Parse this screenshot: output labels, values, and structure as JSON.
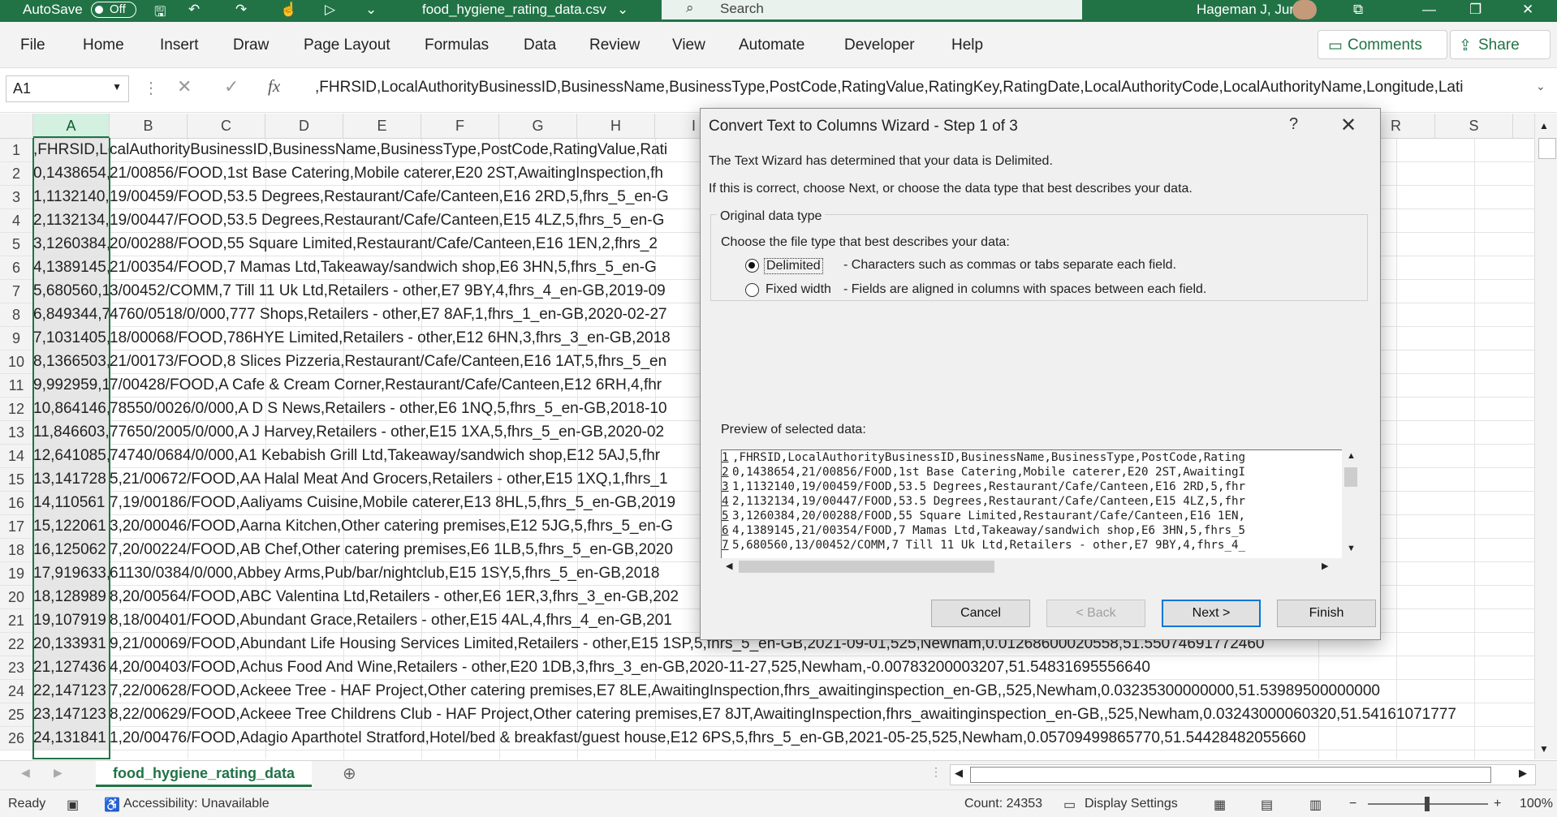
{
  "titlebar": {
    "autosave_label": "AutoSave",
    "autosave_state": "Off",
    "filename": "food_hygiene_rating_data.csv",
    "search_placeholder": "Search",
    "user_name": "Hageman J, Jurre"
  },
  "ribbon": {
    "menu": [
      "File",
      "Home",
      "Insert",
      "Draw",
      "Page Layout",
      "Formulas",
      "Data",
      "Review",
      "View",
      "Automate",
      "Developer",
      "Help"
    ],
    "comments_label": "Comments",
    "share_label": "Share"
  },
  "formula_bar": {
    "name_box": "A1",
    "fx_label": "fx",
    "content": ",FHRSID,LocalAuthorityBusinessID,BusinessName,BusinessType,PostCode,RatingValue,RatingKey,RatingDate,LocalAuthorityCode,LocalAuthorityName,Longitude,Lati"
  },
  "grid": {
    "columns": [
      "A",
      "B",
      "C",
      "D",
      "E",
      "F",
      "G",
      "H",
      "I",
      "R",
      "S"
    ],
    "rows": [
      {
        "n": "1",
        "a": ",FHRSID,Lo",
        "rest": "calAuthorityBusinessID,BusinessName,BusinessType,PostCode,RatingValue,Rati"
      },
      {
        "n": "2",
        "a": "0,1438654,",
        "rest": "21/00856/FOOD,1st Base Catering,Mobile caterer,E20 2ST,AwaitingInspection,fh"
      },
      {
        "n": "3",
        "a": "1,1132140,",
        "rest": "19/00459/FOOD,53.5 Degrees,Restaurant/Cafe/Canteen,E16 2RD,5,fhrs_5_en-G"
      },
      {
        "n": "4",
        "a": "2,1132134,",
        "rest": "19/00447/FOOD,53.5 Degrees,Restaurant/Cafe/Canteen,E15 4LZ,5,fhrs_5_en-G"
      },
      {
        "n": "5",
        "a": "3,1260384,",
        "rest": "20/00288/FOOD,55 Square Limited,Restaurant/Cafe/Canteen,E16 1EN,2,fhrs_2"
      },
      {
        "n": "6",
        "a": "4,1389145,",
        "rest": "21/00354/FOOD,7 Mamas Ltd,Takeaway/sandwich shop,E6 3HN,5,fhrs_5_en-G"
      },
      {
        "n": "7",
        "a": "5,680560,1",
        "rest": "3/00452/COMM,7 Till 11 Uk Ltd,Retailers - other,E7 9BY,4,fhrs_4_en-GB,2019-09"
      },
      {
        "n": "8",
        "a": "6,849344,7",
        "rest": "4760/0518/0/000,777 Shops,Retailers - other,E7 8AF,1,fhrs_1_en-GB,2020-02-27"
      },
      {
        "n": "9",
        "a": "7,1031405,",
        "rest": "18/00068/FOOD,786HYE Limited,Retailers - other,E12 6HN,3,fhrs_3_en-GB,2018"
      },
      {
        "n": "10",
        "a": "8,1366503,",
        "rest": "21/00173/FOOD,8 Slices Pizzeria,Restaurant/Cafe/Canteen,E16 1AT,5,fhrs_5_en"
      },
      {
        "n": "11",
        "a": "9,992959,1",
        "rest": "7/00428/FOOD,A Cafe & Cream Corner,Restaurant/Cafe/Canteen,E12 6RH,4,fhr"
      },
      {
        "n": "12",
        "a": "10,864146,",
        "rest": "78550/0026/0/000,A D S News,Retailers - other,E6 1NQ,5,fhrs_5_en-GB,2018-10"
      },
      {
        "n": "13",
        "a": "11,846603,",
        "rest": "77650/2005/0/000,A J Harvey,Retailers - other,E15 1XA,5,fhrs_5_en-GB,2020-02"
      },
      {
        "n": "14",
        "a": "12,641085,",
        "rest": "74740/0684/0/000,A1 Kebabish Grill Ltd,Takeaway/sandwich shop,E12 5AJ,5,fhr"
      },
      {
        "n": "15",
        "a": "13,141728",
        "rest": "5,21/00672/FOOD,AA Halal Meat And Grocers,Retailers - other,E15 1XQ,1,fhrs_1"
      },
      {
        "n": "16",
        "a": "14,110561",
        "rest": "7,19/00186/FOOD,Aaliyams Cuisine,Mobile caterer,E13 8HL,5,fhrs_5_en-GB,2019"
      },
      {
        "n": "17",
        "a": "15,122061",
        "rest": "3,20/00046/FOOD,Aarna Kitchen,Other catering premises,E12 5JG,5,fhrs_5_en-G"
      },
      {
        "n": "18",
        "a": "16,125062",
        "rest": "7,20/00224/FOOD,AB Chef,Other catering premises,E6 1LB,5,fhrs_5_en-GB,2020"
      },
      {
        "n": "19",
        "a": "17,919633,",
        "rest": "61130/0384/0/000,Abbey Arms,Pub/bar/nightclub,E15 1SY,5,fhrs_5_en-GB,2018"
      },
      {
        "n": "20",
        "a": "18,128989",
        "rest": "8,20/00564/FOOD,ABC Valentina Ltd,Retailers - other,E6 1ER,3,fhrs_3_en-GB,202"
      },
      {
        "n": "21",
        "a": "19,107919",
        "rest": "8,18/00401/FOOD,Abundant Grace,Retailers - other,E15 4AL,4,fhrs_4_en-GB,201"
      },
      {
        "n": "22",
        "a": "20,133931",
        "rest": "9,21/00069/FOOD,Abundant Life Housing Services Limited,Retailers - other,E15 1SP,5,fhrs_5_en-GB,2021-09-01,525,Newham,0.01268600020558,51.55074691772460"
      },
      {
        "n": "23",
        "a": "21,127436",
        "rest": "4,20/00403/FOOD,Achus Food And Wine,Retailers - other,E20 1DB,3,fhrs_3_en-GB,2020-11-27,525,Newham,-0.00783200003207,51.54831695556640"
      },
      {
        "n": "24",
        "a": "22,147123",
        "rest": "7,22/00628/FOOD,Ackeee Tree - HAF Project,Other catering premises,E7 8LE,AwaitingInspection,fhrs_awaitinginspection_en-GB,,525,Newham,0.03235300000000,51.53989500000000"
      },
      {
        "n": "25",
        "a": "23,147123",
        "rest": "8,22/00629/FOOD,Ackeee Tree Childrens Club - HAF Project,Other catering premises,E7 8JT,AwaitingInspection,fhrs_awaitinginspection_en-GB,,525,Newham,0.03243000060320,51.54161071777"
      },
      {
        "n": "26",
        "a": "24,131841",
        "rest": "1,20/00476/FOOD,Adagio Aparthotel Stratford,Hotel/bed & breakfast/guest house,E12 6PS,5,fhrs_5_en-GB,2021-05-25,525,Newham,0.05709499865770,51.54428482055660"
      }
    ]
  },
  "sheet_tab": "food_hygiene_rating_data",
  "status": {
    "ready": "Ready",
    "accessibility": "Accessibility: Unavailable",
    "count": "Count: 24353",
    "display_settings": "Display Settings",
    "zoom": "100%"
  },
  "dialog": {
    "title": "Convert Text to Columns Wizard - Step 1 of 3",
    "help": "?",
    "intro1": "The Text Wizard has determined that your data is Delimited.",
    "intro2": "If this is correct, choose Next, or choose the data type that best describes your data.",
    "group_label": "Original data type",
    "choose_label": "Choose the file type that best describes your data:",
    "opt_delimited": "Delimited",
    "opt_delimited_desc": "- Characters such as commas or tabs separate each field.",
    "opt_fixed": "Fixed width",
    "opt_fixed_desc": "- Fields are aligned in columns with spaces between each field.",
    "preview_label": "Preview of selected data:",
    "preview": [
      {
        "n": "1",
        "t": ",FHRSID,LocalAuthorityBusinessID,BusinessName,BusinessType,PostCode,Rating"
      },
      {
        "n": "2",
        "t": "0,1438654,21/00856/FOOD,1st Base Catering,Mobile caterer,E20 2ST,AwaitingI"
      },
      {
        "n": "3",
        "t": "1,1132140,19/00459/FOOD,53.5 Degrees,Restaurant/Cafe/Canteen,E16 2RD,5,fhr"
      },
      {
        "n": "4",
        "t": "2,1132134,19/00447/FOOD,53.5 Degrees,Restaurant/Cafe/Canteen,E15 4LZ,5,fhr"
      },
      {
        "n": "5",
        "t": "3,1260384,20/00288/FOOD,55 Square Limited,Restaurant/Cafe/Canteen,E16 1EN,"
      },
      {
        "n": "6",
        "t": "4,1389145,21/00354/FOOD,7 Mamas Ltd,Takeaway/sandwich shop,E6 3HN,5,fhrs_5"
      },
      {
        "n": "7",
        "t": "5,680560,13/00452/COMM,7 Till 11 Uk Ltd,Retailers - other,E7 9BY,4,fhrs_4_"
      }
    ],
    "btn_cancel": "Cancel",
    "btn_back": "< Back",
    "btn_next": "Next >",
    "btn_finish": "Finish"
  }
}
